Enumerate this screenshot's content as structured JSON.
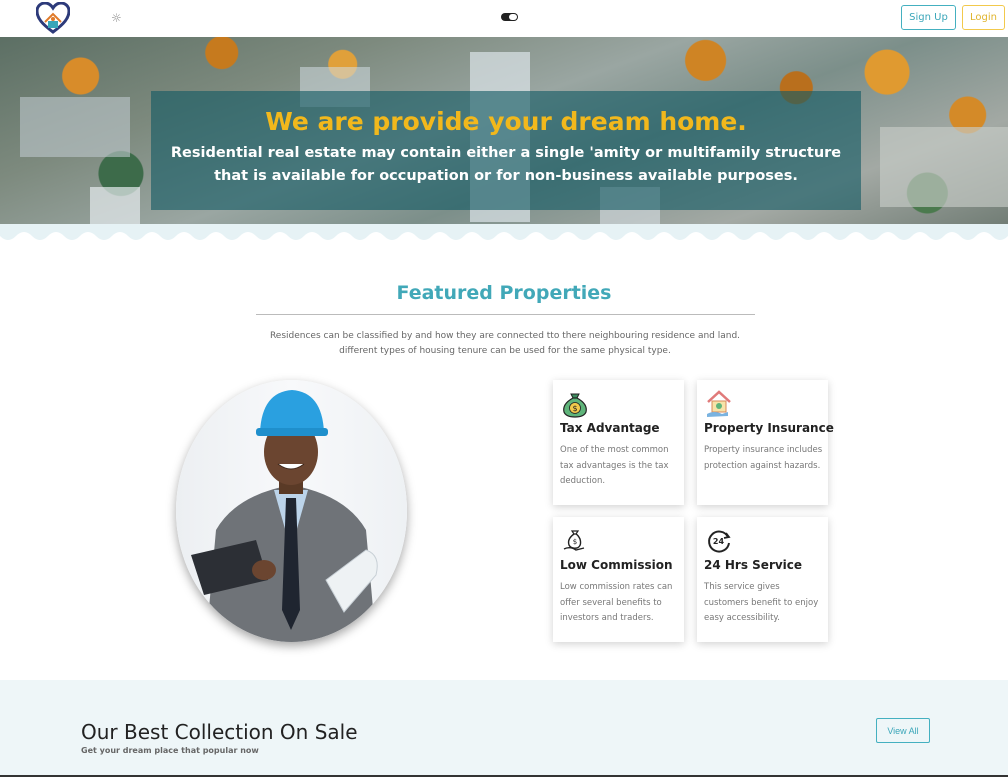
{
  "header": {
    "signup_label": "Sign Up",
    "login_label": "Login"
  },
  "hero": {
    "title": "We are provide your dream home.",
    "text": "Residential real estate may contain either a single 'amity or multifamily structure that is available for occupation or for non-business available purposes."
  },
  "featured": {
    "title": "Featured Properties",
    "desc_line1": "Residences can be classified by and how they are connected tto there neighbouring residence and land.",
    "desc_line2": "different types of housing tenure can be used for the same physical type.",
    "cards": [
      {
        "icon": "money-bag-icon",
        "title": "Tax Advantage",
        "text": "One of the most common tax advantages is the tax deduction."
      },
      {
        "icon": "house-insurance-icon",
        "title": "Property Insurance",
        "text": "Property insurance includes protection against hazards."
      },
      {
        "icon": "commission-icon",
        "title": "Low Commission",
        "text": "Low commission rates can offer several benefits to investors and traders."
      },
      {
        "icon": "24-hours-icon",
        "title": "24 Hrs Service",
        "text": "This service gives customers benefit to enjoy easy accessibility."
      }
    ]
  },
  "collection": {
    "title": "Our Best Collection On Sale",
    "subtitle": "Get your dream place that popular now",
    "view_all_label": "View All"
  },
  "colors": {
    "accent": "#41a8b8",
    "hero_title": "#f2b81c",
    "login": "#f2c94c"
  }
}
